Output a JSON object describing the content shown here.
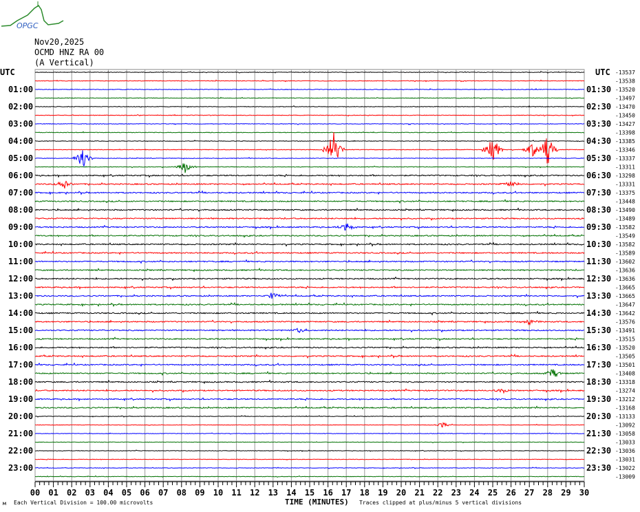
{
  "logo": {
    "text": "OPGC"
  },
  "header": {
    "date": "Nov20,2025",
    "station": "OCMD HNZ RA 00",
    "component": "(A Vertical)"
  },
  "chart_data": {
    "type": "line",
    "subtype": "helicorder",
    "title": "OCMD HNZ RA 00",
    "xlabel": "TIME (MINUTES)",
    "xlim": [
      0,
      30
    ],
    "x_ticks": [
      "00",
      "01",
      "02",
      "03",
      "04",
      "05",
      "06",
      "07",
      "08",
      "09",
      "10",
      "11",
      "12",
      "13",
      "14",
      "15",
      "16",
      "17",
      "18",
      "19",
      "20",
      "21",
      "22",
      "23",
      "24",
      "25",
      "26",
      "27",
      "28",
      "29",
      "30"
    ],
    "left_labels": [
      "UTC",
      "01:00",
      "02:00",
      "03:00",
      "04:00",
      "05:00",
      "06:00",
      "07:00",
      "08:00",
      "09:00",
      "10:00",
      "11:00",
      "12:00",
      "13:00",
      "14:00",
      "15:00",
      "16:00",
      "17:00",
      "18:00",
      "19:00",
      "20:00",
      "21:00",
      "22:00",
      "23:00"
    ],
    "right_labels": [
      "UTC",
      "01:30",
      "02:30",
      "03:30",
      "04:30",
      "05:30",
      "06:30",
      "07:30",
      "08:30",
      "09:30",
      "10:30",
      "11:30",
      "12:30",
      "13:30",
      "14:30",
      "15:30",
      "16:30",
      "17:30",
      "18:30",
      "19:30",
      "20:30",
      "21:30",
      "22:30",
      "23:30"
    ],
    "right_values": [
      "-13537",
      "-13538",
      "-13520",
      "-13497",
      "-13470",
      "-13450",
      "-13427",
      "-13398",
      "-13385",
      "-13346",
      "-13337",
      "-13311",
      "-13298",
      "-13331",
      "-13375",
      "-13448",
      "-13490",
      "-13489",
      "-13582",
      "-13549",
      "-13582",
      "-13589",
      "-13602",
      "-13636",
      "-13636",
      "-13665",
      "-13665",
      "-13647",
      "-13642",
      "-13576",
      "-13491",
      "-13515",
      "-13520",
      "-13505",
      "-13501",
      "-13408",
      "-13318",
      "-13274",
      "-13212",
      "-13168",
      "-13133",
      "-13092",
      "-13058",
      "-13033",
      "-13036",
      "-13031",
      "-13022",
      "-13009"
    ],
    "trace_colors": [
      "#000000",
      "#ff0000",
      "#0000ff",
      "#007000"
    ],
    "grid": true,
    "events": [
      {
        "row": 9,
        "minute": 16.3,
        "amplitude": 5
      },
      {
        "row": 9,
        "minute": 25.0,
        "amplitude": 4
      },
      {
        "row": 9,
        "minute": 28.0,
        "amplitude": 4
      },
      {
        "row": 9,
        "minute": 27.2,
        "amplitude": 2
      },
      {
        "row": 10,
        "minute": 2.6,
        "amplitude": 2.5
      },
      {
        "row": 11,
        "minute": 8.2,
        "amplitude": 1.5
      },
      {
        "row": 13,
        "minute": 1.6,
        "amplitude": 1.2
      },
      {
        "row": 13,
        "minute": 26.0,
        "amplitude": 1
      },
      {
        "row": 18,
        "minute": 17.0,
        "amplitude": 1.2
      },
      {
        "row": 26,
        "minute": 13.0,
        "amplitude": 1
      },
      {
        "row": 29,
        "minute": 27.0,
        "amplitude": 1
      },
      {
        "row": 30,
        "minute": 14.5,
        "amplitude": 0.8
      },
      {
        "row": 35,
        "minute": 28.3,
        "amplitude": 1.2
      },
      {
        "row": 37,
        "minute": 25.5,
        "amplitude": 0.8
      },
      {
        "row": 41,
        "minute": 22.3,
        "amplitude": 0.7
      }
    ]
  },
  "footer": {
    "scale": "Each Vertical Division =  100.00 microvolts",
    "xlabel": "TIME (MINUTES)",
    "clip_note": "Traces clipped at plus/minus 5 vertical divisions"
  }
}
